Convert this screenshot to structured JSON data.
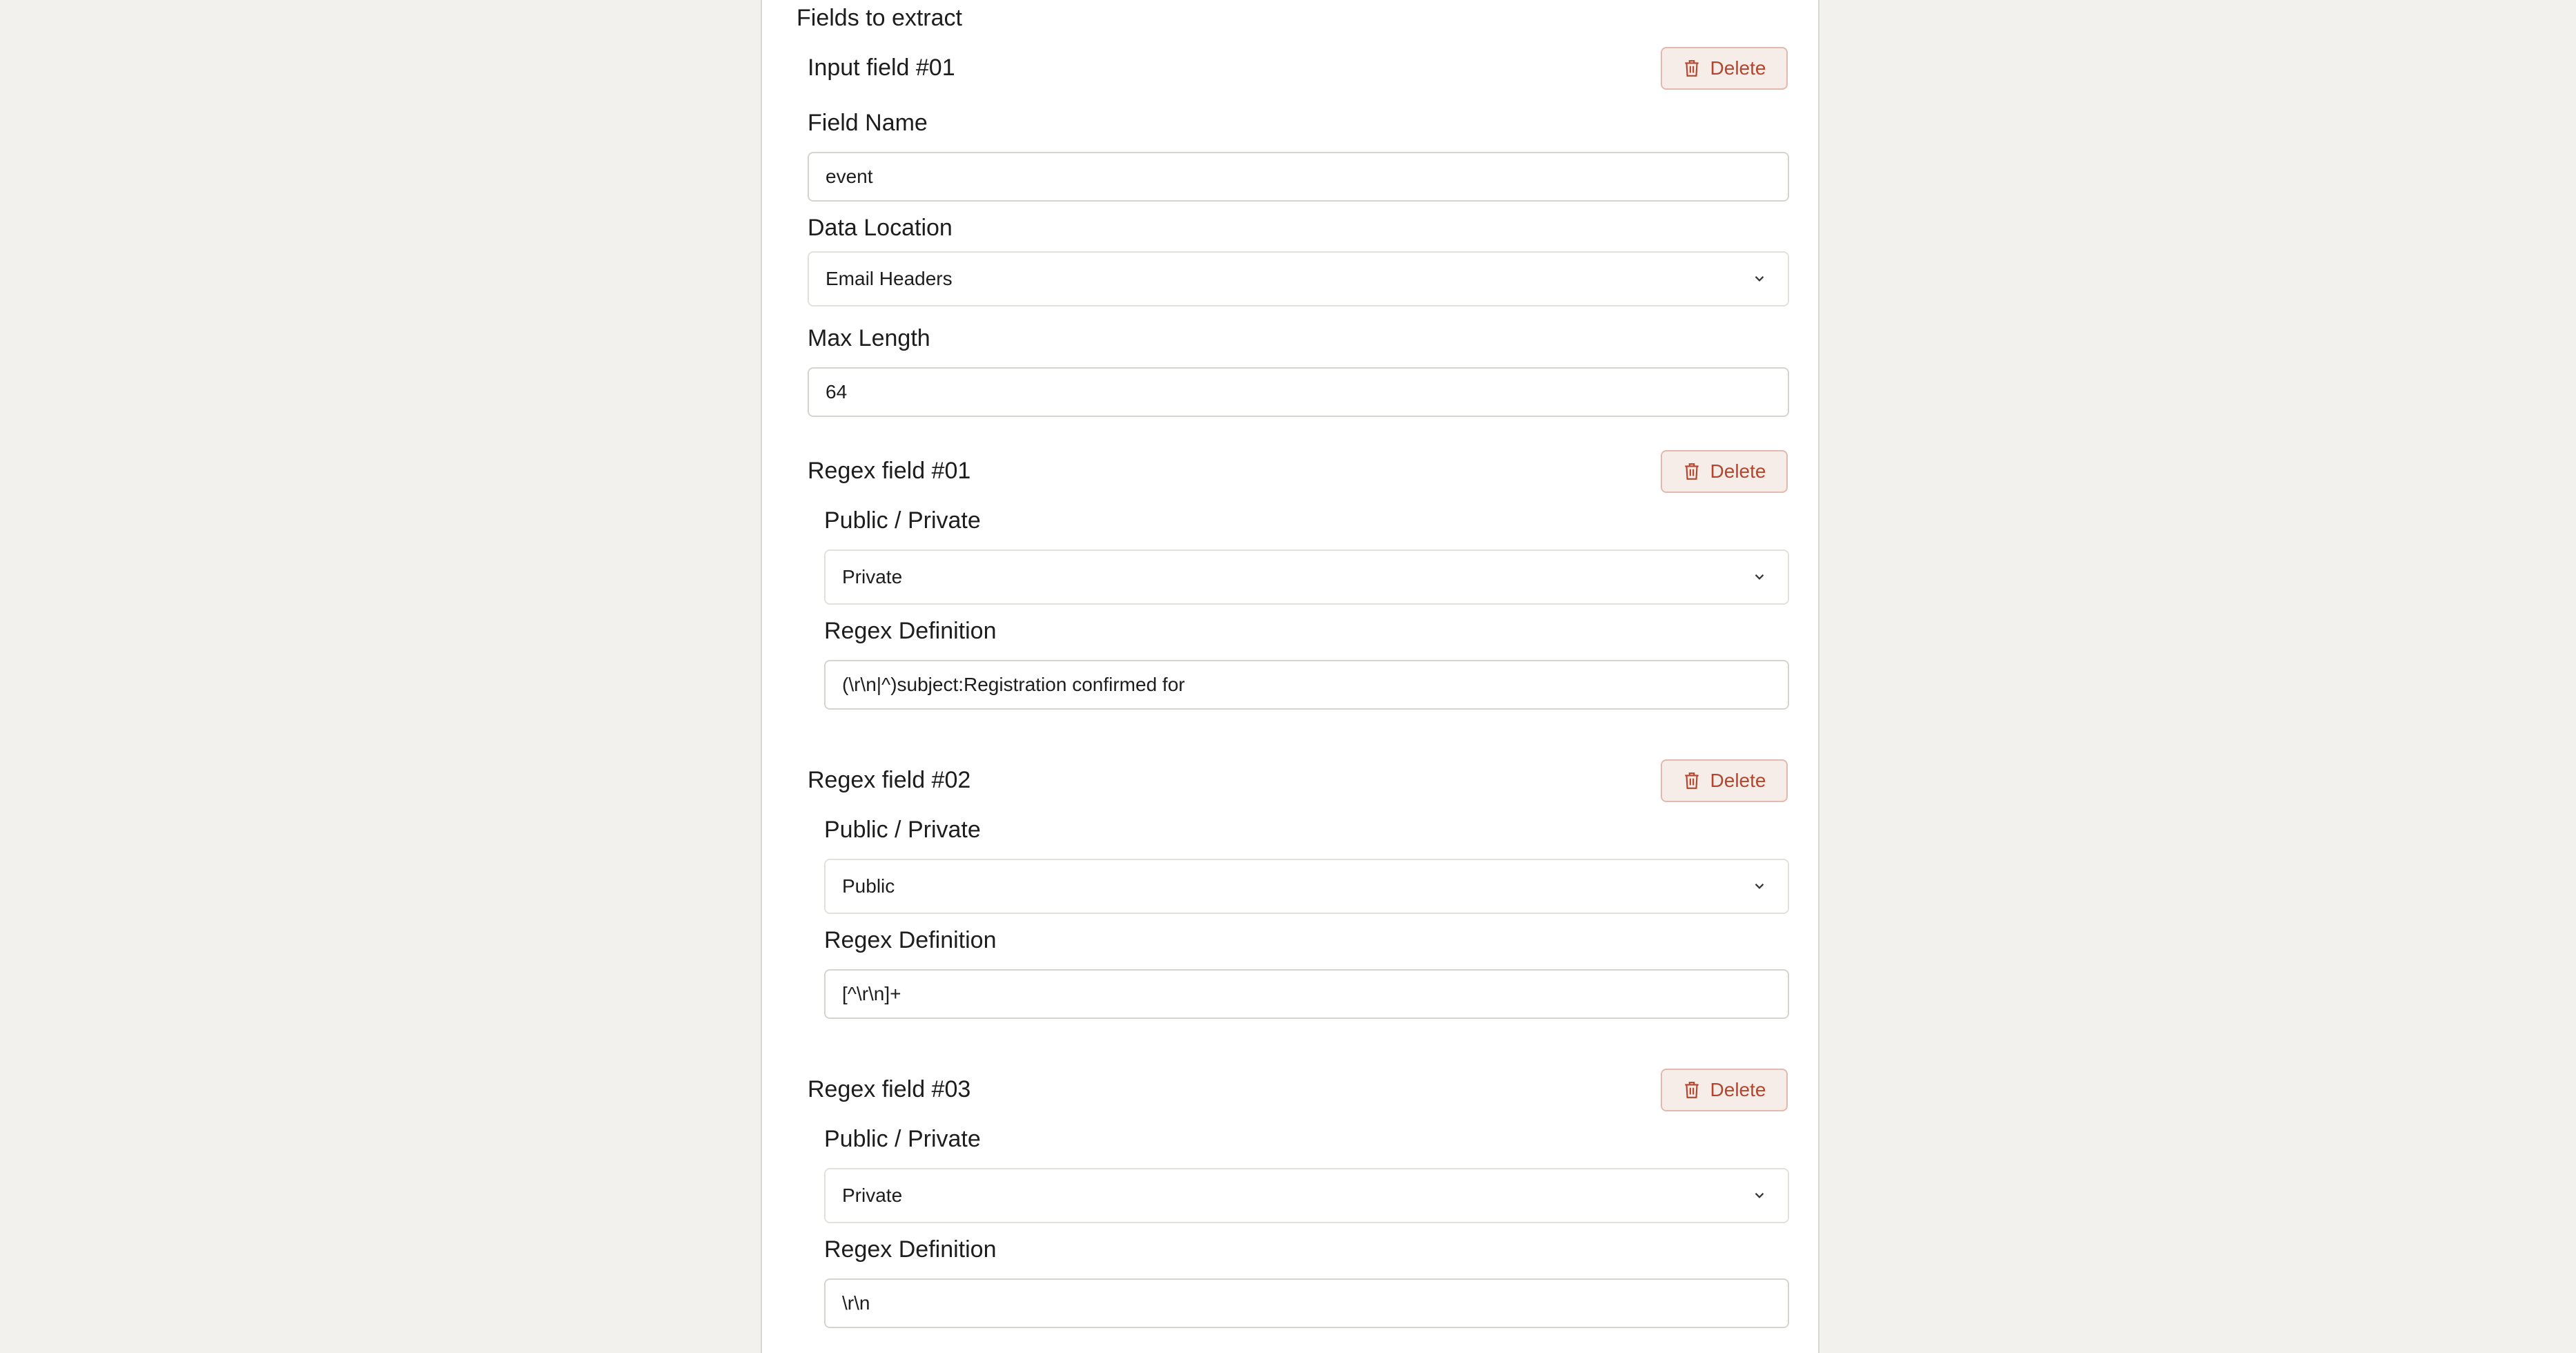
{
  "section": {
    "title": "Fields to extract"
  },
  "input_field": {
    "title": "Input field #01",
    "delete_label": "Delete",
    "field_name_label": "Field Name",
    "field_name_value": "event",
    "data_location_label": "Data Location",
    "data_location_value": "Email Headers",
    "max_length_label": "Max Length",
    "max_length_value": "64"
  },
  "regex_fields": [
    {
      "title": "Regex field #01",
      "delete_label": "Delete",
      "visibility_label": "Public / Private",
      "visibility_value": "Private",
      "definition_label": "Regex Definition",
      "definition_value": "(\\r\\n|^)subject:Registration confirmed for"
    },
    {
      "title": "Regex field #02",
      "delete_label": "Delete",
      "visibility_label": "Public / Private",
      "visibility_value": "Public",
      "definition_label": "Regex Definition",
      "definition_value": "[^\\r\\n]+"
    },
    {
      "title": "Regex field #03",
      "delete_label": "Delete",
      "visibility_label": "Public / Private",
      "visibility_value": "Private",
      "definition_label": "Regex Definition",
      "definition_value": "\\r\\n"
    }
  ],
  "colors": {
    "page_background": "#f2f1ed",
    "panel_background": "#ffffff",
    "delete_text": "#b5452c",
    "delete_background": "#f6ece8",
    "delete_border": "#e3b9ae"
  },
  "icons": {
    "delete": "trash-icon",
    "select": "chevron-down-icon"
  }
}
